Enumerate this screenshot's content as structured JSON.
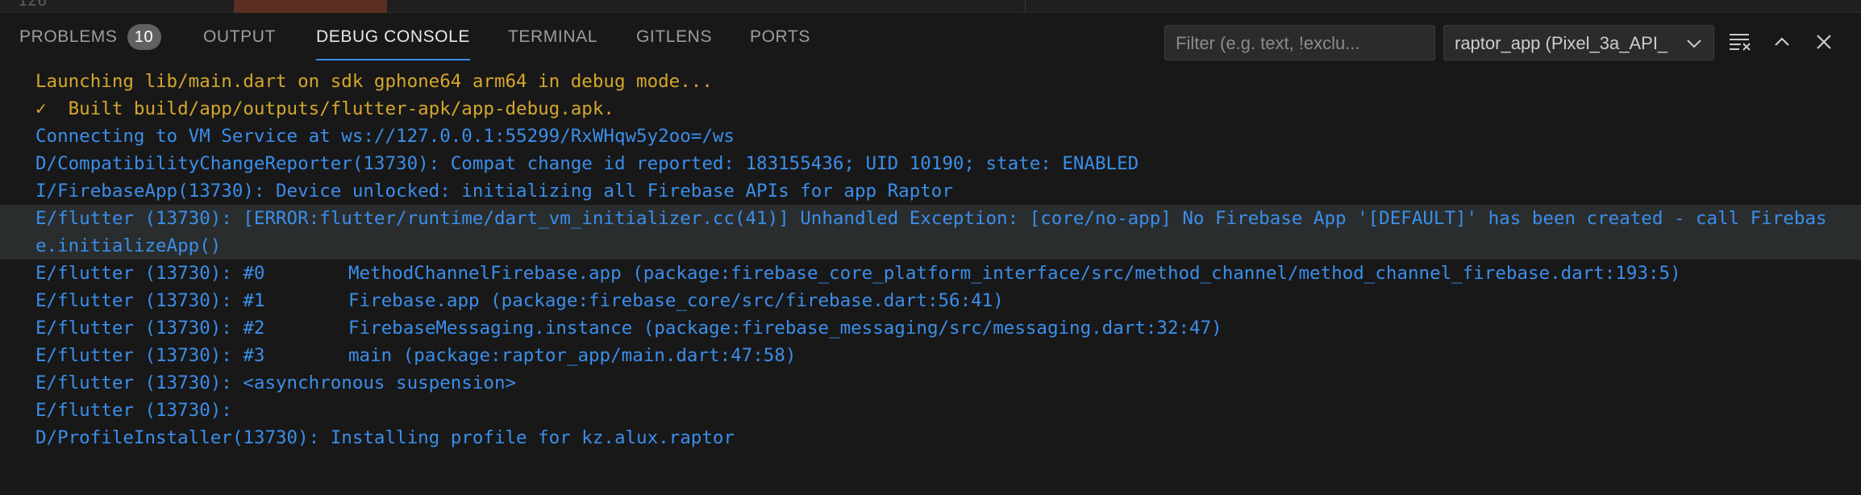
{
  "editor": {
    "line_number": "126"
  },
  "tabs": [
    {
      "label": "PROBLEMS",
      "badge": "10"
    },
    {
      "label": "OUTPUT"
    },
    {
      "label": "DEBUG CONSOLE"
    },
    {
      "label": "TERMINAL"
    },
    {
      "label": "GITLENS"
    },
    {
      "label": "PORTS"
    }
  ],
  "filter": {
    "placeholder": "Filter (e.g. text, !exclu..."
  },
  "session_select": {
    "value": "raptor_app (Pixel_3a_API_"
  },
  "icons": {
    "clear": "clear-console-icon",
    "maximize": "chevron-up-icon",
    "close": "close-icon",
    "dropdown": "chevron-down-icon"
  },
  "colors": {
    "info_yellow": "#d4a72c",
    "log_blue": "#3b8eea",
    "active_tab_underline": "#3b8eea"
  },
  "console": {
    "lines": [
      "Launching lib/main.dart on sdk gphone64 arm64 in debug mode...",
      "✓  Built build/app/outputs/flutter-apk/app-debug.apk.",
      "Connecting to VM Service at ws://127.0.0.1:55299/RxWHqw5y2oo=/ws",
      "D/CompatibilityChangeReporter(13730): Compat change id reported: 183155436; UID 10190; state: ENABLED",
      "I/FirebaseApp(13730): Device unlocked: initializing all Firebase APIs for app Raptor",
      "E/flutter (13730): [ERROR:flutter/runtime/dart_vm_initializer.cc(41)] Unhandled Exception: [core/no-app] No Firebase App '[DEFAULT]' has been created - call Firebase.initializeApp()",
      "E/flutter (13730): #0",
      "MethodChannelFirebase.app (package:firebase_core_platform_interface/src/method_channel/method_channel_firebase.dart:193:5)",
      "E/flutter (13730): #1",
      "Firebase.app (package:firebase_core/src/firebase.dart:56:41)",
      "E/flutter (13730): #2",
      "FirebaseMessaging.instance (package:firebase_messaging/src/messaging.dart:32:47)",
      "E/flutter (13730): #3",
      "main (package:raptor_app/main.dart:47:58)",
      "E/flutter (13730): <asynchronous suspension>",
      "E/flutter (13730):",
      "D/ProfileInstaller(13730): Installing profile for kz.alux.raptor"
    ]
  }
}
